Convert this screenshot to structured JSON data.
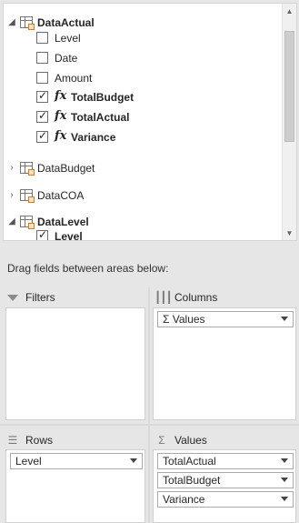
{
  "field_list": {
    "tables": [
      {
        "name": "DataActual",
        "expanded": true,
        "fields": [
          {
            "name": "Level",
            "checked": false,
            "calculated": false
          },
          {
            "name": "Date",
            "checked": false,
            "calculated": false
          },
          {
            "name": "Amount",
            "checked": false,
            "calculated": false
          },
          {
            "name": "TotalBudget",
            "checked": true,
            "calculated": true
          },
          {
            "name": "TotalActual",
            "checked": true,
            "calculated": true
          },
          {
            "name": "Variance",
            "checked": true,
            "calculated": true
          }
        ]
      },
      {
        "name": "DataBudget",
        "expanded": false
      },
      {
        "name": "DataCOA",
        "expanded": false
      },
      {
        "name": "DataLevel",
        "expanded": true,
        "fields": [
          {
            "name": "Level",
            "checked": true,
            "calculated": false
          }
        ]
      }
    ],
    "fx_glyph": "fx"
  },
  "instruction": "Drag fields between areas below:",
  "areas": {
    "filters": {
      "label": "Filters",
      "icon": "filter-icon",
      "items": []
    },
    "columns": {
      "label": "Columns",
      "icon": "columns-icon",
      "items": [
        "Σ Values"
      ]
    },
    "rows": {
      "label": "Rows",
      "icon": "rows-icon",
      "items": [
        "Level"
      ]
    },
    "values": {
      "label": "Values",
      "icon": "sigma-icon",
      "items": [
        "TotalActual",
        "TotalBudget",
        "Variance"
      ]
    }
  },
  "colors": {
    "table_highlight": "#d87b1d",
    "background": "#e6e6e6"
  }
}
